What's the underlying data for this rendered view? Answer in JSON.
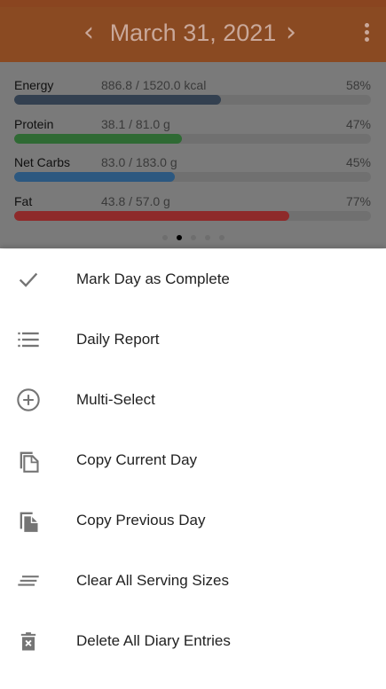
{
  "header": {
    "date": "March 31, 2021",
    "prev_icon": "chevron-left-icon",
    "next_icon": "chevron-right-icon",
    "more_icon": "more-vert-icon"
  },
  "nutrients": [
    {
      "label": "Energy",
      "amount": "886.8 / 1520.0 kcal",
      "percent": "58%",
      "fraction": 0.58,
      "color": "#334050"
    },
    {
      "label": "Protein",
      "amount": "38.1 / 81.0 g",
      "percent": "47%",
      "fraction": 0.47,
      "color": "#2f6a34"
    },
    {
      "label": "Net Carbs",
      "amount": "83.0 / 183.0 g",
      "percent": "45%",
      "fraction": 0.45,
      "color": "#2c5880"
    },
    {
      "label": "Fat",
      "amount": "43.8 / 57.0 g",
      "percent": "77%",
      "fraction": 0.77,
      "color": "#8e2a2a"
    }
  ],
  "pager": {
    "count": 5,
    "active": 1
  },
  "menu": [
    {
      "label": "Mark Day as Complete",
      "icon": "check-icon"
    },
    {
      "label": "Daily Report",
      "icon": "list-icon"
    },
    {
      "label": "Multi-Select",
      "icon": "add-circle-icon"
    },
    {
      "label": "Copy Current Day",
      "icon": "copy-icon"
    },
    {
      "label": "Copy Previous Day",
      "icon": "copy-filled-icon"
    },
    {
      "label": "Clear All Serving Sizes",
      "icon": "clear-all-icon"
    },
    {
      "label": "Delete All Diary Entries",
      "icon": "delete-icon"
    }
  ],
  "colors": {
    "accent": "#d9622b",
    "icon": "#757575"
  }
}
